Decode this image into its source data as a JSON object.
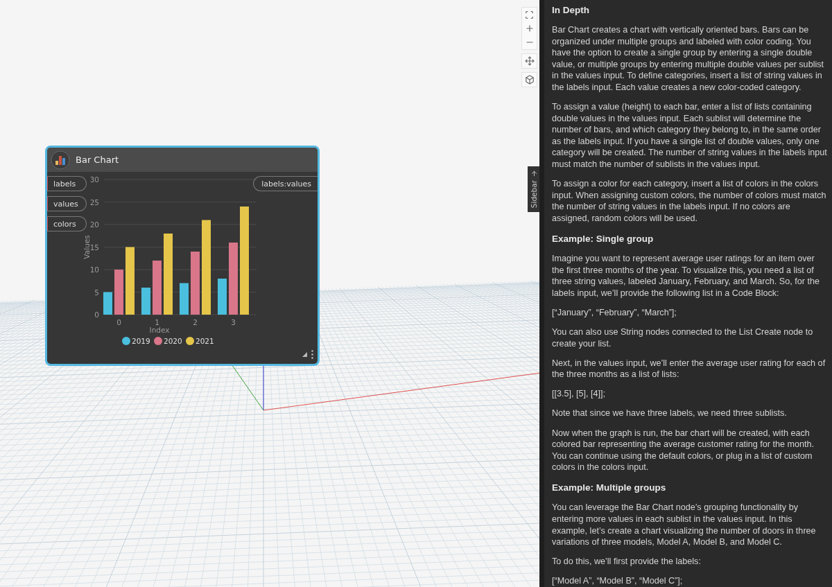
{
  "canvas": {
    "node": {
      "title": "Bar Chart",
      "inputs": [
        {
          "label": "labels"
        },
        {
          "label": "values"
        },
        {
          "label": "colors"
        }
      ],
      "output": "labels:values",
      "chart_data": {
        "type": "bar",
        "grid": true,
        "legend": true,
        "xlabel": "Index",
        "ylabel": "Values",
        "categories": [
          "0",
          "1",
          "2",
          "3"
        ],
        "ylim": [
          0,
          30
        ],
        "yticks": [
          0,
          5,
          10,
          15,
          20,
          25,
          30
        ],
        "series": [
          {
            "name": "2019",
            "color": "#4bbfde",
            "values": [
              5,
              6,
              7,
              8
            ]
          },
          {
            "name": "2020",
            "color": "#d9768a",
            "values": [
              10,
              12,
              14,
              16
            ]
          },
          {
            "name": "2021",
            "color": "#e5c64a",
            "values": [
              15,
              18,
              21,
              24
            ]
          }
        ]
      }
    }
  },
  "sidebar_tab": {
    "label": "Sidebar"
  },
  "panel": {
    "blocks": [
      {
        "kind": "heading",
        "text": "In Depth"
      },
      {
        "kind": "paragraph",
        "text": "Bar Chart creates a chart with vertically oriented bars. Bars can be organized under multiple groups and labeled with color coding. You have the option to create a single group by entering a single double value, or multiple groups by entering multiple double values per sublist in the values input. To define categories, insert a list of string values in the labels input. Each value creates a new color-coded category."
      },
      {
        "kind": "paragraph",
        "text": "To assign a value (height) to each bar, enter a list of lists containing double values in the values input. Each sublist will determine the number of bars, and which category they belong to, in the same order as the labels input. If you have a single list of double values, only one category will be created. The number of string values in the labels input must match the number of sublists in the values input."
      },
      {
        "kind": "paragraph",
        "text": "To assign a color for each category, insert a list of colors in the colors input. When assigning custom colors, the number of colors must match the number of string values in the labels input. If no colors are assigned, random colors will be used."
      },
      {
        "kind": "heading",
        "text": "Example: Single group"
      },
      {
        "kind": "paragraph",
        "text": "Imagine you want to represent average user ratings for an item over the first three months of the year. To visualize this, you need a list of three string values, labeled January, February, and March. So, for the labels input, we’ll provide the following list in a Code Block:"
      },
      {
        "kind": "paragraph",
        "text": "[“January”, “February”, “March”];"
      },
      {
        "kind": "paragraph",
        "text": "You can also use String nodes connected to the List Create node to create your list."
      },
      {
        "kind": "paragraph",
        "text": "Next, in the values input, we’ll enter the average user rating for each of the three months as a list of lists:"
      },
      {
        "kind": "paragraph",
        "text": "[[3.5], [5], [4]];"
      },
      {
        "kind": "paragraph",
        "text": "Note that since we have three labels, we need three sublists."
      },
      {
        "kind": "paragraph",
        "text": "Now when the graph is run, the bar chart will be created, with each colored bar representing the average customer rating for the month. You can continue using the default colors, or plug in a list of custom colors in the colors input."
      },
      {
        "kind": "heading",
        "text": "Example: Multiple groups"
      },
      {
        "kind": "paragraph",
        "text": "You can leverage the Bar Chart node’s grouping functionality by entering more values in each sublist in the values input. In this example, let’s create a chart visualizing the number of doors in three variations of three models, Model A, Model B, and Model C."
      },
      {
        "kind": "paragraph",
        "text": "To do this, we’ll first provide the labels:"
      },
      {
        "kind": "paragraph",
        "text": "[“Model A”, “Model B”, “Model C”];"
      }
    ]
  }
}
